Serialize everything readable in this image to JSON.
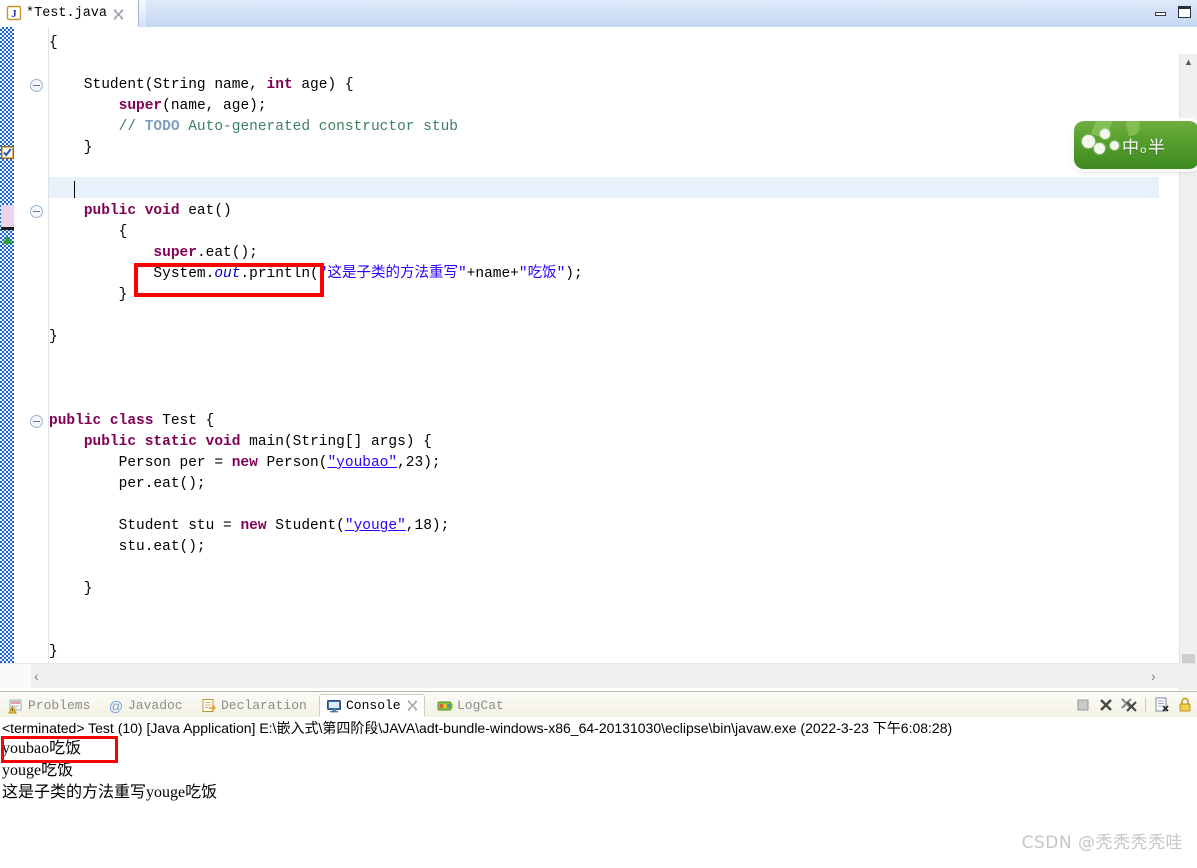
{
  "window": {
    "minimize_label": "minimize",
    "maximize_label": "maximize"
  },
  "editor": {
    "tab": {
      "label": "*Test.java",
      "icon": "java-file-icon",
      "close_icon": "close-icon",
      "dirty": true
    },
    "caret_line_index": 7,
    "code_lines": [
      {
        "indent": 0,
        "tokens": [
          {
            "t": "{",
            "c": "plain"
          }
        ]
      },
      {
        "indent": 0,
        "tokens": []
      },
      {
        "indent": 0,
        "tokens": [
          {
            "t": "    Student(String name, ",
            "c": "plain"
          },
          {
            "t": "int",
            "c": "kw"
          },
          {
            "t": " age) {",
            "c": "plain"
          }
        ]
      },
      {
        "indent": 0,
        "tokens": [
          {
            "t": "        ",
            "c": "plain"
          },
          {
            "t": "super",
            "c": "kw"
          },
          {
            "t": "(name, age);",
            "c": "plain"
          }
        ]
      },
      {
        "indent": 0,
        "tokens": [
          {
            "t": "        // ",
            "c": "cmt"
          },
          {
            "t": "TODO",
            "c": "todo"
          },
          {
            "t": " Auto-generated constructor stub",
            "c": "cmt"
          }
        ]
      },
      {
        "indent": 0,
        "tokens": [
          {
            "t": "    }",
            "c": "plain"
          }
        ]
      },
      {
        "indent": 0,
        "tokens": []
      },
      {
        "indent": 0,
        "tokens": []
      },
      {
        "indent": 0,
        "tokens": [
          {
            "t": "    ",
            "c": "plain"
          },
          {
            "t": "public void",
            "c": "kw"
          },
          {
            "t": " eat()",
            "c": "plain"
          }
        ]
      },
      {
        "indent": 0,
        "tokens": [
          {
            "t": "        {",
            "c": "plain"
          }
        ]
      },
      {
        "indent": 0,
        "tokens": [
          {
            "t": "            ",
            "c": "plain"
          },
          {
            "t": "super",
            "c": "kw"
          },
          {
            "t": ".eat();",
            "c": "plain"
          }
        ]
      },
      {
        "indent": 0,
        "tokens": [
          {
            "t": "            System.",
            "c": "plain"
          },
          {
            "t": "out",
            "c": "fld"
          },
          {
            "t": ".println(",
            "c": "plain"
          },
          {
            "t": "\"这是子类的方法重写\"",
            "c": "str"
          },
          {
            "t": "+name+",
            "c": "plain"
          },
          {
            "t": "\"吃饭\"",
            "c": "str"
          },
          {
            "t": ");",
            "c": "plain"
          }
        ]
      },
      {
        "indent": 0,
        "tokens": [
          {
            "t": "        }",
            "c": "plain"
          }
        ]
      },
      {
        "indent": 0,
        "tokens": []
      },
      {
        "indent": 0,
        "tokens": [
          {
            "t": "}",
            "c": "plain"
          }
        ]
      },
      {
        "indent": 0,
        "tokens": []
      },
      {
        "indent": 0,
        "tokens": []
      },
      {
        "indent": 0,
        "tokens": []
      },
      {
        "indent": 0,
        "tokens": [
          {
            "t": "public class",
            "c": "kw"
          },
          {
            "t": " Test {",
            "c": "plain"
          }
        ]
      },
      {
        "indent": 0,
        "tokens": [
          {
            "t": "    ",
            "c": "plain"
          },
          {
            "t": "public static void",
            "c": "kw"
          },
          {
            "t": " main(String[] args) {",
            "c": "plain"
          }
        ]
      },
      {
        "indent": 0,
        "tokens": [
          {
            "t": "        Person per = ",
            "c": "plain"
          },
          {
            "t": "new",
            "c": "kw"
          },
          {
            "t": " Person(",
            "c": "plain"
          },
          {
            "t": "\"youbao\"",
            "c": "str lnk"
          },
          {
            "t": ",23);",
            "c": "plain"
          }
        ]
      },
      {
        "indent": 0,
        "tokens": [
          {
            "t": "        per.eat();",
            "c": "plain"
          }
        ]
      },
      {
        "indent": 0,
        "tokens": []
      },
      {
        "indent": 0,
        "tokens": [
          {
            "t": "        Student stu = ",
            "c": "plain"
          },
          {
            "t": "new",
            "c": "kw"
          },
          {
            "t": " Student(",
            "c": "plain"
          },
          {
            "t": "\"youge\"",
            "c": "str lnk"
          },
          {
            "t": ",18);",
            "c": "plain"
          }
        ]
      },
      {
        "indent": 0,
        "tokens": [
          {
            "t": "        stu.eat();",
            "c": "plain"
          }
        ]
      },
      {
        "indent": 0,
        "tokens": []
      },
      {
        "indent": 0,
        "tokens": [
          {
            "t": "    }",
            "c": "plain"
          }
        ]
      },
      {
        "indent": 0,
        "tokens": []
      },
      {
        "indent": 0,
        "tokens": []
      },
      {
        "indent": 0,
        "tokens": [
          {
            "t": "}",
            "c": "plain"
          }
        ]
      }
    ],
    "annotation_highlight": {
      "label": "super-eat-highlight",
      "color": "#ff0000"
    },
    "scroll": {
      "up_arrow": "▲",
      "down_arrow": "▼",
      "left_arrow": "‹",
      "right_arrow": "›"
    }
  },
  "bottom_view": {
    "tabs": [
      {
        "label": "Problems",
        "icon": "problems-icon",
        "active": false,
        "closable": false
      },
      {
        "label": "Javadoc",
        "icon": "javadoc-icon",
        "active": false,
        "closable": false
      },
      {
        "label": "Declaration",
        "icon": "declaration-icon",
        "active": false,
        "closable": false
      },
      {
        "label": "Console",
        "icon": "console-icon",
        "active": true,
        "closable": true
      },
      {
        "label": "LogCat",
        "icon": "logcat-icon",
        "active": false,
        "closable": false
      }
    ],
    "toolbar": [
      {
        "name": "terminate-button",
        "glyph": "stop",
        "enabled": false
      },
      {
        "name": "remove-launch-button",
        "glyph": "x",
        "enabled": true
      },
      {
        "name": "remove-all-terminated-button",
        "glyph": "xx",
        "enabled": true
      },
      {
        "name": "clear-console-button",
        "glyph": "clear",
        "enabled": true
      },
      {
        "name": "scroll-lock-button",
        "glyph": "lock",
        "enabled": true
      }
    ],
    "console": {
      "terminated_line": "<terminated> Test (10) [Java Application] E:\\嵌入式\\第四阶段\\JAVA\\adt-bundle-windows-x86_64-20131030\\eclipse\\bin\\javaw.exe (2022-3-23 下午6:08:28)",
      "output_lines": [
        "youbao吃饭",
        "youge吃饭",
        "这是子类的方法重写youge吃饭"
      ],
      "highlight": {
        "label": "youbao-output-highlight",
        "color": "#ff0000"
      }
    }
  },
  "ime_bar": {
    "text": "中ₒ半",
    "color": "#4f9a2a"
  },
  "watermark": {
    "text": "CSDN @秃秃秃秃哇"
  }
}
